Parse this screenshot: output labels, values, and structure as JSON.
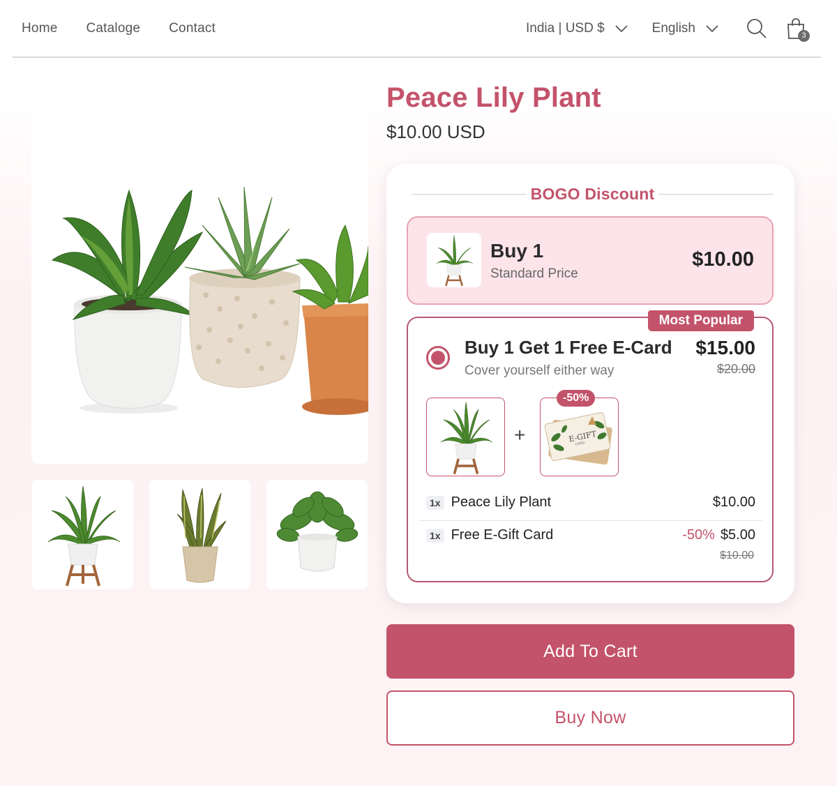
{
  "header": {
    "nav": [
      "Home",
      "Cataloge",
      "Contact"
    ],
    "country_selector": "India | USD $",
    "language_selector": "English",
    "cart_count": "3"
  },
  "product": {
    "title": "Peace Lily Plant",
    "price": "$10.00 USD"
  },
  "bundle": {
    "heading": "BOGO Discount",
    "option1": {
      "title": "Buy 1",
      "subtitle": "Standard Price",
      "price": "$10.00"
    },
    "option2": {
      "badge": "Most Popular",
      "title": "Buy 1 Get 1 Free E-Card",
      "subtitle": "Cover yourself either way",
      "price": "$15.00",
      "compare_price": "$20.00",
      "discount_pill": "-50%",
      "plus": "+",
      "items": [
        {
          "qty": "1x",
          "name": "Peace Lily Plant",
          "price": "$10.00"
        },
        {
          "qty": "1x",
          "name": "Free E-Gift Card",
          "discount": "-50%",
          "price": "$5.00",
          "compare": "$10.00"
        }
      ]
    }
  },
  "buttons": {
    "add_to_cart": "Add To Cart",
    "buy_now": "Buy Now"
  },
  "gift_card_text": "E-GIFT",
  "gift_card_subtext": "CARD",
  "colors": {
    "accent": "#c3536a",
    "accent_light": "#fde4ea",
    "accent_border": "#e7a3b2"
  }
}
